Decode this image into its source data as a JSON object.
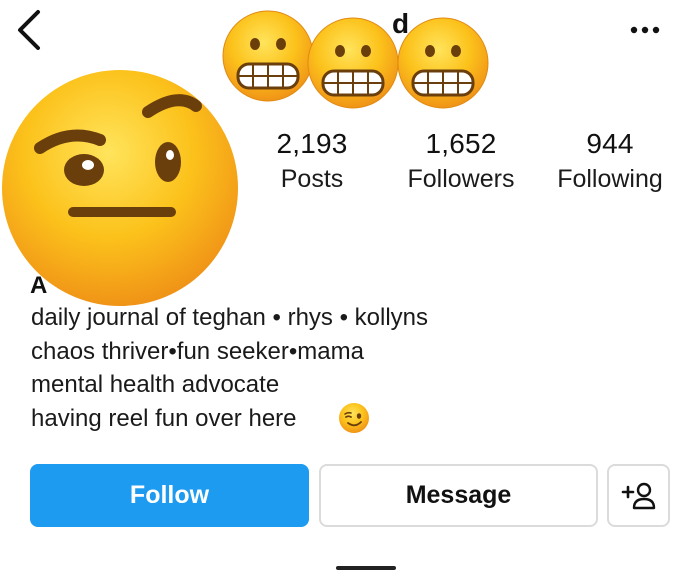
{
  "header": {
    "username_fragment": "d",
    "back_icon": "chevron-left-icon",
    "more_icon": "more-horizontal-icon"
  },
  "profile": {
    "avatar_icon": "raised-eyebrow-emoji",
    "name_fragment": "A"
  },
  "stats": [
    {
      "value": "2,193",
      "label": "Posts"
    },
    {
      "value": "1,652",
      "label": "Followers"
    },
    {
      "value": "944",
      "label": "Following"
    }
  ],
  "bio": {
    "line1": "daily journal of teghan • rhys • kollyns",
    "line2": "chaos thriver•fun seeker•mama",
    "line3": "mental health advocate",
    "line4": "having reel fun over here"
  },
  "actions": {
    "follow_label": "Follow",
    "message_label": "Message",
    "add_icon": "add-person-icon"
  },
  "colors": {
    "follow_bg": "#1d9bf0",
    "emoji_yellow": "#fcc21b",
    "emoji_orange": "#f29a1e"
  }
}
